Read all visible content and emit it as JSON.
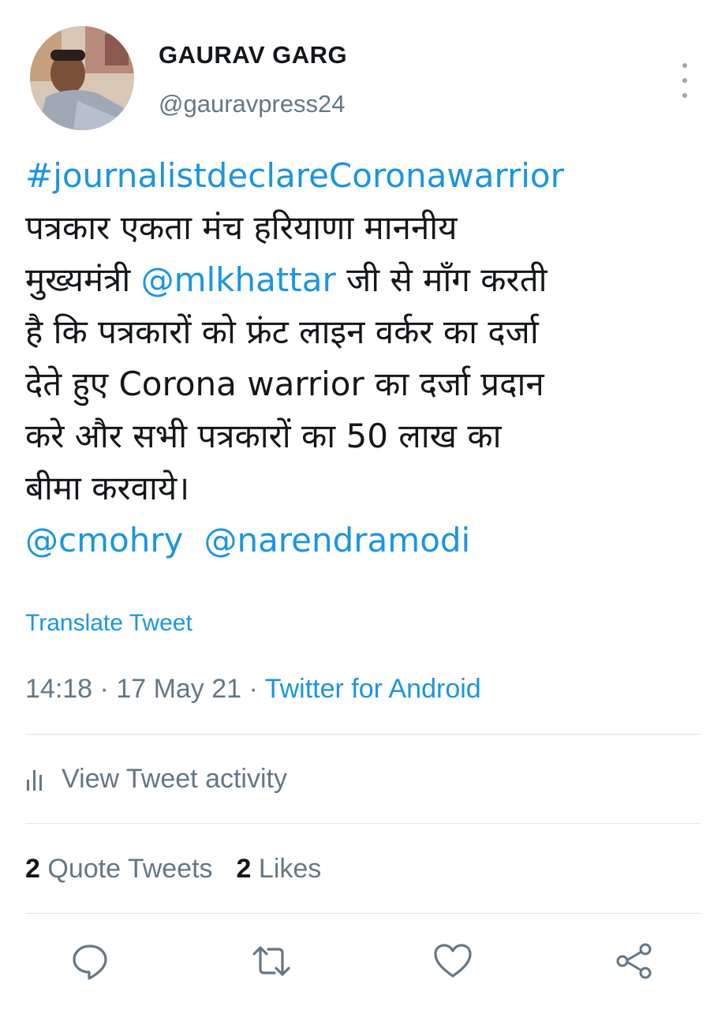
{
  "user": {
    "display_name": "GAURAV GARG",
    "handle": "@gauravpress24"
  },
  "tweet": {
    "hashtag": "#journalistdeclareCoronawarrior",
    "line1": "पत्रकार एकता मंच हरियाणा माननीय",
    "line2_pre": "मुख्यमंत्री ",
    "mention1": "@mlkhattar",
    "line2_post": " जी से माँग करती",
    "line3": "है कि पत्रकारों को फ्रंट लाइन वर्कर का दर्जा",
    "line4": "देते हुए Corona warrior का दर्जा प्रदान",
    "line5": "करे और सभी पत्रकारों का 50 लाख का",
    "line6": "बीमा करवाये।",
    "mention2": "@cmohry",
    "mention3": "@narendramodi"
  },
  "translate_label": "Translate Tweet",
  "meta": {
    "time": "14:18",
    "separator": " · ",
    "date": "17 May 21",
    "source": "Twitter for Android"
  },
  "activity_label": "View Tweet activity",
  "stats": {
    "quote_count": "2",
    "quote_label": "Quote Tweets",
    "like_count": "2",
    "like_label": "Likes"
  },
  "icons": {
    "more": "more-vertical-icon",
    "activity": "bar-chart-icon",
    "reply": "reply-icon",
    "retweet": "retweet-icon",
    "like": "heart-icon",
    "share": "share-icon"
  },
  "colors": {
    "link": "#1b95e0",
    "secondary_text": "#657786",
    "primary_text": "#14171a",
    "icon": "#657786"
  }
}
